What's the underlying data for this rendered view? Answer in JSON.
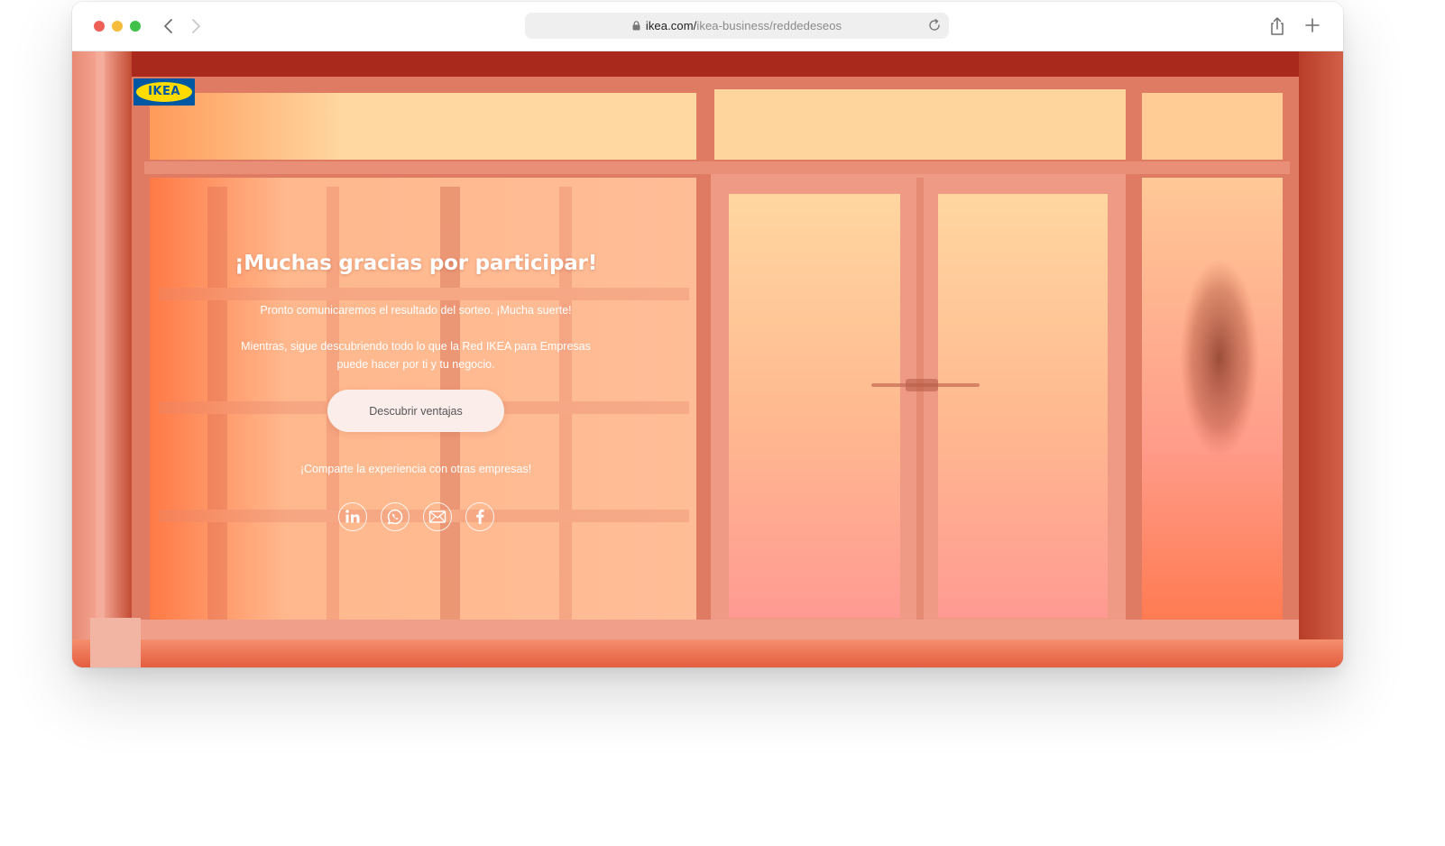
{
  "browser": {
    "url_host": "ikea.com/",
    "url_path": "ikea-business/reddedeseos"
  },
  "brand": {
    "logo_text": "IKEA",
    "logo_blue": "#0058a3",
    "logo_yellow": "#ffdb00"
  },
  "hero": {
    "headline": "¡Muchas gracias por participar!",
    "paragraph1": "Pronto comunicaremos el resultado del sorteo. ¡Mucha suerte!",
    "paragraph2": "Mientras, sigue descubriendo todo lo que la Red IKEA para Empresas puede hacer por ti y tu negocio.",
    "cta_label": "Descubrir ventajas",
    "share_text": "¡Comparte la experiencia con otras empresas!"
  },
  "social_icons": [
    "linkedin-icon",
    "whatsapp-icon",
    "email-icon",
    "facebook-icon"
  ],
  "colors": {
    "window_wall": "#c8523c",
    "panel_glow": "#ffd39b",
    "panel_pink": "#ff9c92",
    "button_bg": "#fbeeea"
  }
}
